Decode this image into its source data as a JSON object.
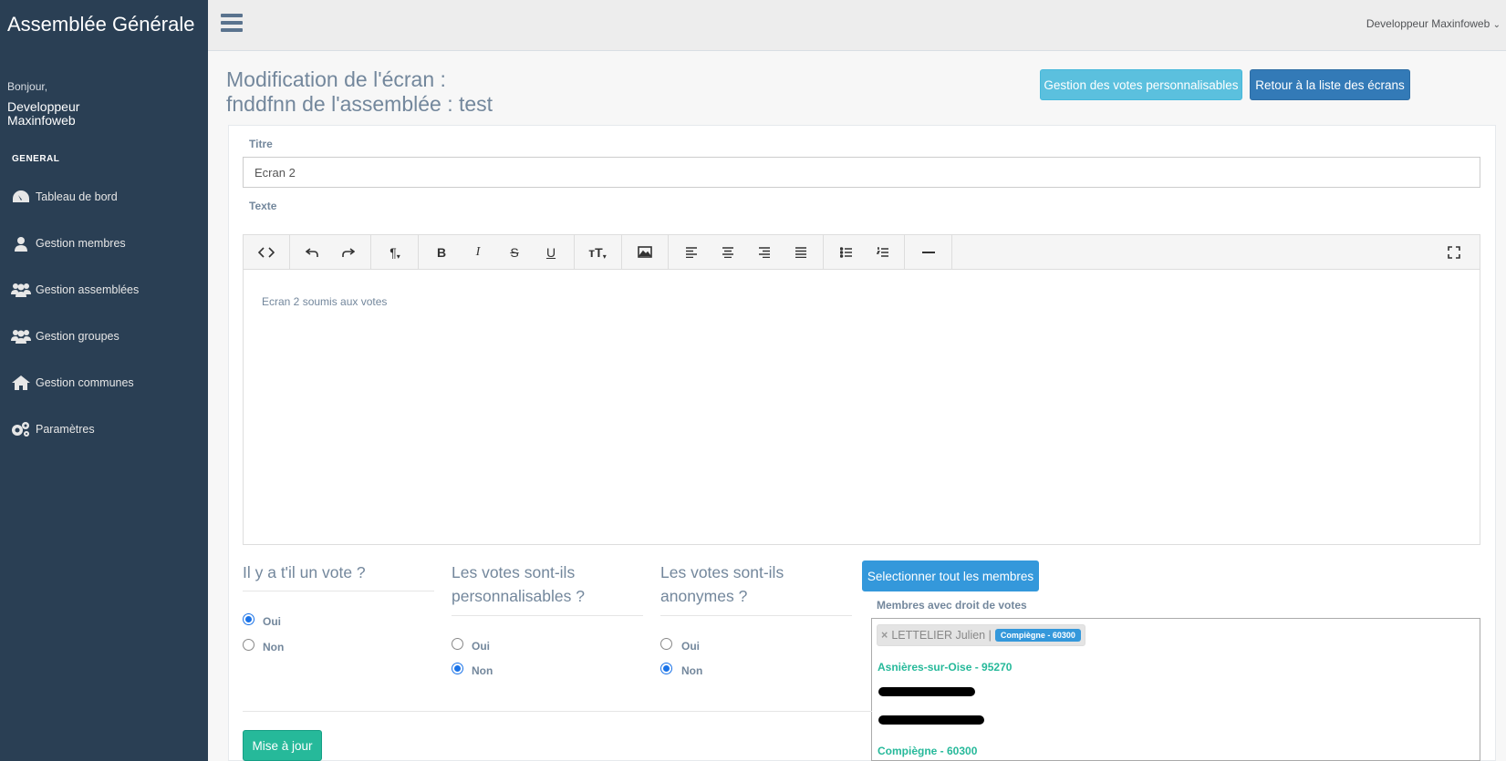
{
  "sidebar": {
    "app_title": "Assemblée Générale",
    "greeting": "Bonjour,",
    "username": "Developpeur Maxinfoweb",
    "section": "GENERAL",
    "items": [
      {
        "label": "Tableau de bord",
        "icon": "dashboard-icon"
      },
      {
        "label": "Gestion membres",
        "icon": "user-icon"
      },
      {
        "label": "Gestion assemblées",
        "icon": "users-icon"
      },
      {
        "label": "Gestion groupes",
        "icon": "users-icon"
      },
      {
        "label": "Gestion communes",
        "icon": "home-icon"
      },
      {
        "label": "Paramètres",
        "icon": "gears-icon"
      }
    ]
  },
  "topbar": {
    "user_menu": "Developpeur Maxinfoweb"
  },
  "header": {
    "title_line1": "Modification de l'écran :",
    "title_line2": "fnddfnn de l'assemblée : test",
    "btn_custom_votes": "Gestion des votes personnalisables",
    "btn_back": "Retour à la liste des écrans"
  },
  "form": {
    "title_label": "Titre",
    "title_value": "Ecran 2",
    "text_label": "Texte",
    "editor_content": "Ecran 2 soumis aux votes",
    "q1": {
      "text": "Il y a t'il un vote ?",
      "yes": "Oui",
      "no": "Non",
      "selected": "Oui"
    },
    "q2": {
      "text": "Les votes sont-ils personnalisables ?",
      "yes": "Oui",
      "no": "Non",
      "selected": "Non"
    },
    "q3": {
      "text": "Les votes sont-ils anonymes ?",
      "yes": "Oui",
      "no": "Non",
      "selected": "Non"
    },
    "select_all_btn": "Selectionner tout les membres",
    "members_label": "Membres avec droit de votes",
    "selected_tag": {
      "name": "LETTELIER Julien |",
      "badge": "Compiègne - 60300"
    },
    "dropdown_groups": [
      "Asnières-sur-Oise - 95270",
      "Compiègne - 60300"
    ],
    "submit": "Mise à jour"
  },
  "colors": {
    "sidebar_bg": "#2a3f54",
    "accent_green": "#26b99a",
    "primary_blue": "#337ab7",
    "info_blue": "#5bc0de"
  }
}
